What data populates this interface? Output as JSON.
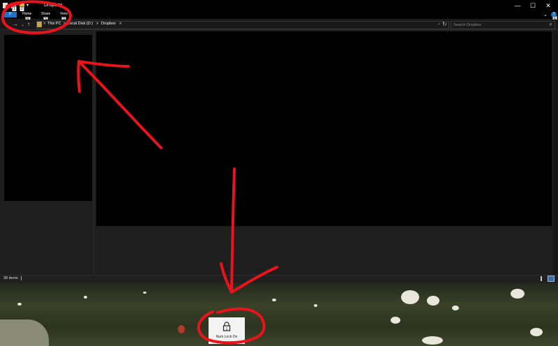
{
  "window": {
    "title": "Dropbox",
    "controls": {
      "minimize": "—",
      "maximize": "☐",
      "close": "✕"
    }
  },
  "quick_access": {
    "keytips": [
      "1",
      "2"
    ]
  },
  "ribbon": {
    "file_tab": {
      "label": "F"
    },
    "tabs": [
      {
        "label": "Home",
        "keytip": "H"
      },
      {
        "label": "Share",
        "keytip": "S"
      },
      {
        "label": "View",
        "keytip": "V"
      }
    ],
    "help_keytip": "E"
  },
  "address_bar": {
    "breadcrumbs": [
      "This PC",
      "Local Disk (D:)",
      "Dropbox"
    ],
    "separator": ">"
  },
  "search": {
    "placeholder": "Search Dropbox"
  },
  "status_bar": {
    "item_count": "38 items"
  },
  "toast": {
    "text": "Num Lock On",
    "icon": "lock-icon"
  },
  "annotations": {
    "color": "#e8131b"
  }
}
